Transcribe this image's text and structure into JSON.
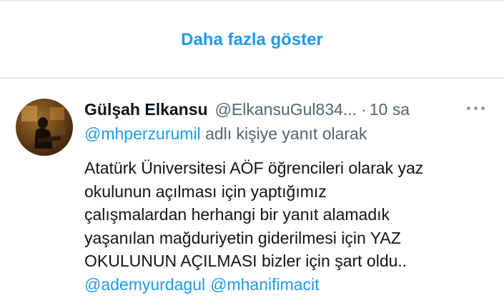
{
  "show_more": {
    "label": "Daha fazla göster"
  },
  "tweet": {
    "author": {
      "display_name": "Gülşah Elkansu",
      "handle": "@ElkansuGul834..."
    },
    "separator": "·",
    "time": "10 sa",
    "reply_to": {
      "mention": "@mhperzurumil",
      "suffix": "adlı kişiye yanıt olarak"
    },
    "text_lines": [
      "Atatürk Üniversitesi AÖF öğrencileri olarak yaz",
      "okulunun açılması için yaptığımız",
      "çalışmalardan herhangi bir yanıt alamadık",
      "yaşanılan mağduriyetin giderilmesi için YAZ",
      "OKULUNUN AÇILMASI bizler için şart oldu.."
    ],
    "mentions": [
      "@ademyurdagul",
      "@mhanifimacit"
    ]
  },
  "icons": {
    "more": "more-horizontal-icon",
    "avatar": "avatar-photo"
  },
  "colors": {
    "link": "#1d9bf0",
    "secondary": "#536471",
    "primary": "#0f1419",
    "divider": "#e7e9ea"
  }
}
